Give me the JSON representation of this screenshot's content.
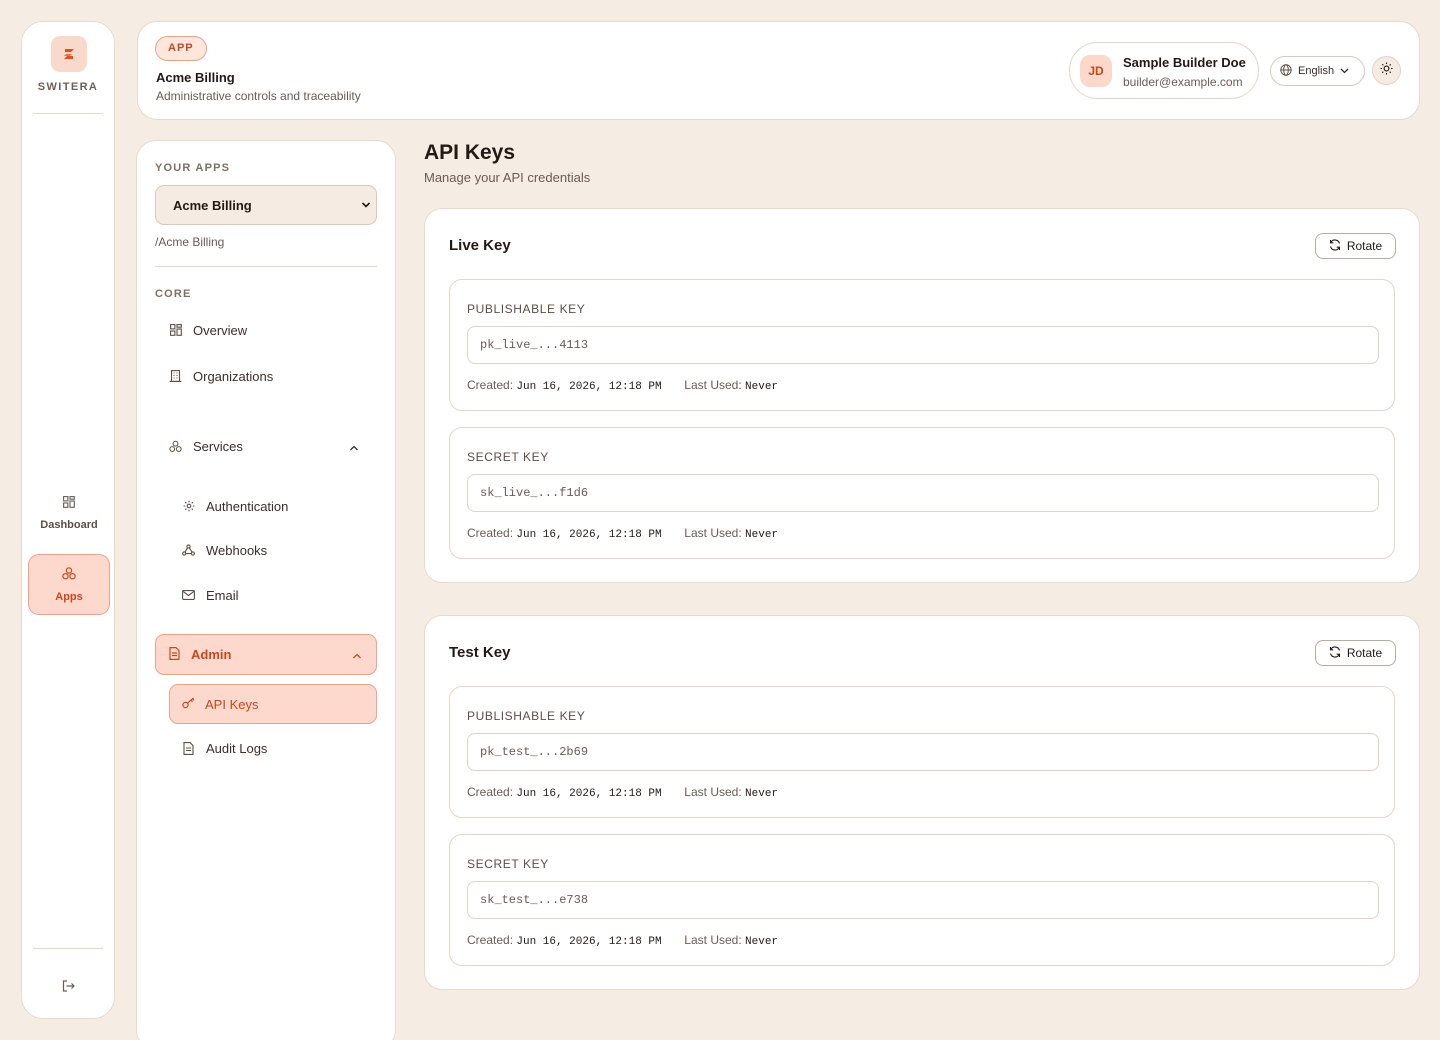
{
  "brand": {
    "name": "SWITERA"
  },
  "rail": {
    "items": [
      {
        "label": "Dashboard"
      },
      {
        "label": "Apps"
      }
    ]
  },
  "topbar": {
    "badge": "APP",
    "title": "Acme Billing",
    "subtitle": "Administrative controls and traceability",
    "user": {
      "initials": "JD",
      "name": "Sample Builder Doe",
      "email": "builder@example.com"
    },
    "language": "English"
  },
  "sidebar": {
    "your_apps_label": "YOUR APPS",
    "selected_app": "Acme Billing",
    "app_path": "/Acme Billing",
    "core_label": "CORE",
    "core_items": [
      {
        "label": "Overview"
      },
      {
        "label": "Organizations"
      }
    ],
    "services": {
      "label": "Services",
      "items": [
        {
          "label": "Authentication"
        },
        {
          "label": "Webhooks"
        },
        {
          "label": "Email"
        }
      ]
    },
    "admin": {
      "label": "Admin",
      "items": [
        {
          "label": "API Keys"
        },
        {
          "label": "Audit Logs"
        }
      ]
    }
  },
  "main": {
    "title": "API Keys",
    "subtitle": "Manage your API credentials",
    "cards": [
      {
        "title": "Live Key",
        "rotate_label": "Rotate",
        "keys": [
          {
            "label": "PUBLISHABLE KEY",
            "value": "pk_live_...4113",
            "created_label": "Created:",
            "created": "Jun 16, 2026, 12:18 PM",
            "last_used_label": "Last Used:",
            "last_used": "Never"
          },
          {
            "label": "SECRET KEY",
            "value": "sk_live_...f1d6",
            "created_label": "Created:",
            "created": "Jun 16, 2026, 12:18 PM",
            "last_used_label": "Last Used:",
            "last_used": "Never"
          }
        ]
      },
      {
        "title": "Test Key",
        "rotate_label": "Rotate",
        "keys": [
          {
            "label": "PUBLISHABLE KEY",
            "value": "pk_test_...2b69",
            "created_label": "Created:",
            "created": "Jun 16, 2026, 12:18 PM",
            "last_used_label": "Last Used:",
            "last_used": "Never"
          },
          {
            "label": "SECRET KEY",
            "value": "sk_test_...e738",
            "created_label": "Created:",
            "created": "Jun 16, 2026, 12:18 PM",
            "last_used_label": "Last Used:",
            "last_used": "Never"
          }
        ]
      }
    ]
  },
  "colors": {
    "accent": "#c6491d",
    "accent_bg": "#fdd9cd",
    "page_bg": "#f5ece3"
  },
  "icons": {
    "logo": "brand-logo-icon",
    "dashboard": "grid-icon",
    "apps": "apps-icon",
    "logout": "logout-icon",
    "language": "globe-icon",
    "theme": "sun-icon",
    "rotate": "refresh-icon"
  }
}
